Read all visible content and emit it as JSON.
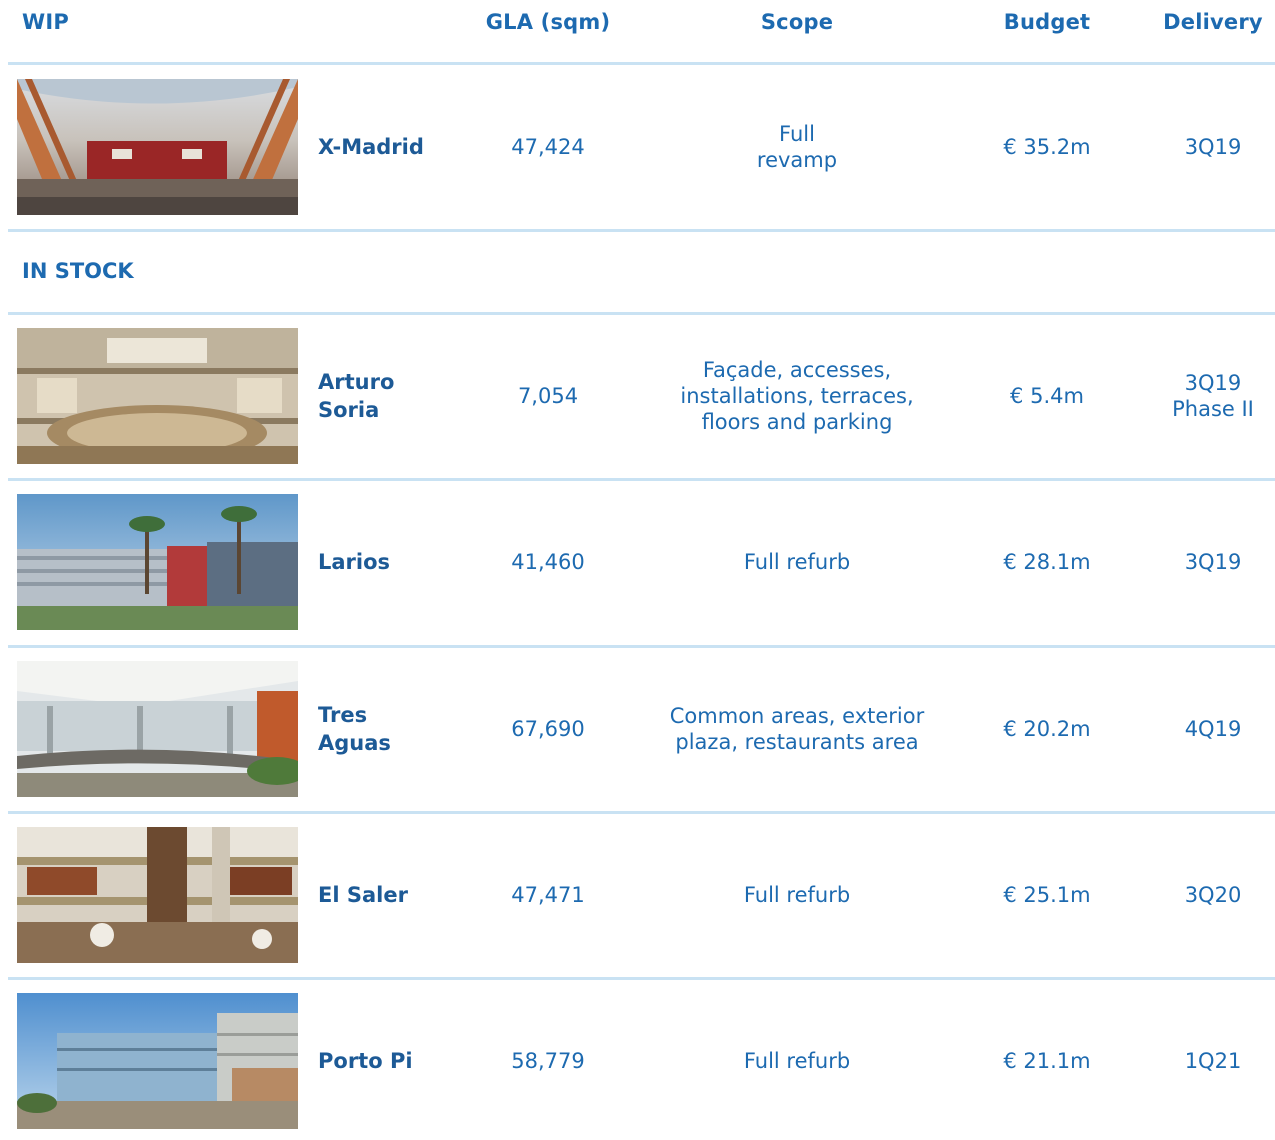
{
  "header": {
    "wip": "WIP",
    "gla": "GLA (sqm)",
    "scope": "Scope",
    "budget": "Budget",
    "delivery": "Delivery"
  },
  "sections": {
    "in_stock": "IN STOCK"
  },
  "rows": [
    {
      "name": "X-Madrid",
      "gla": "47,424",
      "scope": "Full\nrevamp",
      "budget": "€ 35.2m",
      "delivery": "3Q19",
      "image": "mall-interior-red-photo"
    },
    {
      "name": "Arturo\nSoria",
      "gla": "7,054",
      "scope": "Façade, accesses,\ninstallations, terraces,\nfloors and parking",
      "budget": "€ 5.4m",
      "delivery": "3Q19\nPhase II",
      "image": "mall-atrium-photo"
    },
    {
      "name": "Larios",
      "gla": "41,460",
      "scope": "Full refurb",
      "budget": "€ 28.1m",
      "delivery": "3Q19",
      "image": "mall-exterior-palms-photo"
    },
    {
      "name": "Tres\nAguas",
      "gla": "67,690",
      "scope": "Common areas, exterior\nplaza, restaurants area",
      "budget": "€ 20.2m",
      "delivery": "4Q19",
      "image": "mall-plaza-canopy-photo"
    },
    {
      "name": "El Saler",
      "gla": "47,471",
      "scope": "Full refurb",
      "budget": "€ 25.1m",
      "delivery": "3Q20",
      "image": "mall-food-court-photo"
    },
    {
      "name": "Porto Pi",
      "gla": "58,779",
      "scope": "Full refurb",
      "budget": "€ 21.1m",
      "delivery": "1Q21",
      "image": "mall-glass-building-photo"
    }
  ]
}
